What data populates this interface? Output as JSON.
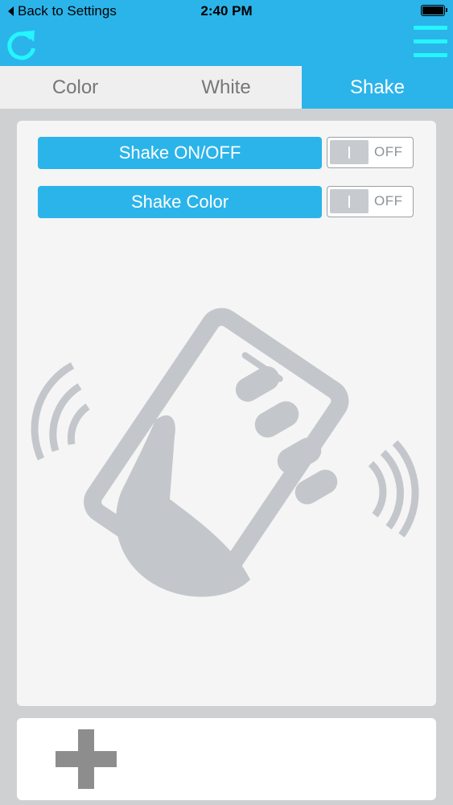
{
  "status_bar": {
    "back_label": "Back to Settings",
    "time": "2:40 PM"
  },
  "icons": {
    "refresh": "refresh-icon",
    "menu": "hamburger-menu-icon",
    "back": "back-arrow-icon",
    "battery": "battery-icon",
    "add": "plus-icon",
    "illustration": "hand-shaking-phone-icon"
  },
  "tabs": [
    {
      "label": "Color",
      "active": false
    },
    {
      "label": "White",
      "active": false
    },
    {
      "label": "Shake",
      "active": true
    }
  ],
  "settings": [
    {
      "label": "Shake ON/OFF",
      "state": "OFF"
    },
    {
      "label": "Shake Color",
      "state": "OFF"
    }
  ],
  "colors": {
    "accent": "#2bb4ea",
    "menu_icon": "#25f5ff",
    "illustration": "#c3c7cb",
    "plus": "#8d8d8d"
  }
}
